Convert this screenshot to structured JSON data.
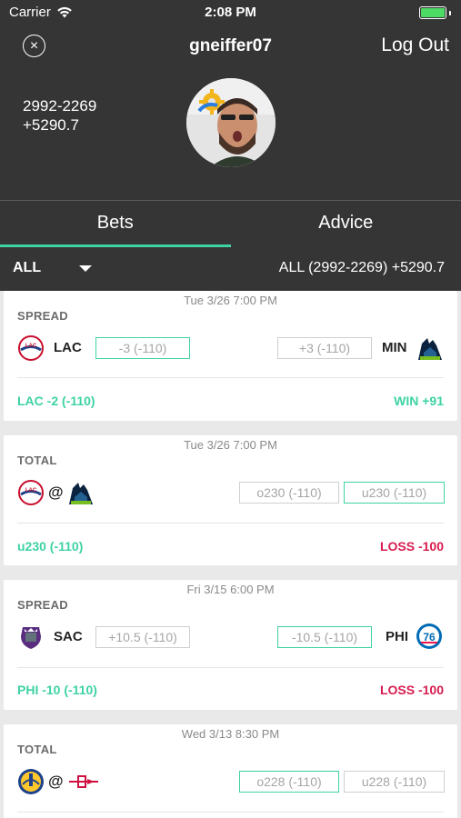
{
  "status_bar": {
    "carrier": "Carrier",
    "time": "2:08 PM"
  },
  "header": {
    "username": "gneiffer07",
    "logout_label": "Log Out",
    "record": "2992-2269",
    "profit": "+5290.7"
  },
  "tabs": [
    {
      "label": "Bets",
      "active": true
    },
    {
      "label": "Advice",
      "active": false
    }
  ],
  "filter": {
    "selected": "ALL",
    "summary": "ALL (2992-2269) +5290.7"
  },
  "bets": [
    {
      "date": "Tue 3/26 7:00 PM",
      "type": "SPREAD",
      "away_team": "LAC",
      "home_team": "MIN",
      "away_line": "-3 (-110)",
      "home_line": "+3 (-110)",
      "pick": "LAC -2 (-110)",
      "result": "WIN +91"
    },
    {
      "date": "Tue 3/26 7:00 PM",
      "type": "TOTAL",
      "at": "@",
      "over_line": "o230 (-110)",
      "under_line": "u230 (-110)",
      "pick": "u230 (-110)",
      "result": "LOSS -100"
    },
    {
      "date": "Fri 3/15 6:00 PM",
      "type": "SPREAD",
      "away_team": "SAC",
      "home_team": "PHI",
      "away_line": "+10.5 (-110)",
      "home_line": "-10.5 (-110)",
      "pick": "PHI -10 (-110)",
      "result": "LOSS -100"
    },
    {
      "date": "Wed 3/13 8:30 PM",
      "type": "TOTAL",
      "at": "@",
      "over_line": "o228 (-110)",
      "under_line": "u228 (-110)"
    }
  ],
  "colors": {
    "accent": "#3ed2a4",
    "loss": "#d81b4d",
    "header_bg": "#353535"
  },
  "icons": [
    "wifi-icon",
    "battery-icon",
    "close-icon",
    "chevron-down-icon",
    "clippers-logo",
    "timberwolves-logo",
    "kings-logo",
    "76ers-logo",
    "warriors-logo",
    "rockets-logo"
  ]
}
